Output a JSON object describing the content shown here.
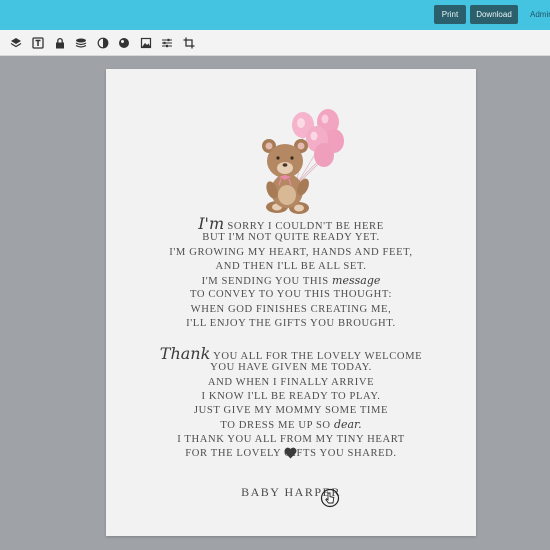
{
  "header": {
    "print_label": "Print",
    "download_label": "Download",
    "admin_label": "Admin"
  },
  "toolbar": {
    "tools": [
      "layers-icon",
      "text-icon",
      "lock-icon",
      "stack-icon",
      "contrast-icon",
      "color-icon",
      "image-icon",
      "adjust-icon",
      "crop-icon"
    ]
  },
  "poem": {
    "stanza1": [
      {
        "script": "I'm",
        "text": "SORRY I COULDN'T BE HERE"
      },
      {
        "text": "BUT I'M NOT QUITE READY YET."
      },
      {
        "text": "I'M GROWING MY HEART, HANDS AND FEET,"
      },
      {
        "text": "AND THEN I'LL BE ALL SET."
      },
      {
        "text": "I'M SENDING YOU THIS",
        "script_after": "message"
      },
      {
        "text": "TO CONVEY TO YOU THIS THOUGHT:"
      },
      {
        "text": "WHEN GOD FINISHES CREATING ME,"
      },
      {
        "text": "I'LL ENJOY THE GIFTS YOU BROUGHT."
      }
    ],
    "stanza2": [
      {
        "script": "Thank",
        "text": "YOU ALL FOR THE LOVELY WELCOME"
      },
      {
        "text": "YOU HAVE GIVEN ME TODAY."
      },
      {
        "text": "AND WHEN I FINALLY ARRIVE"
      },
      {
        "text": "I KNOW I'LL BE READY TO PLAY."
      },
      {
        "text": "JUST GIVE MY MOMMY SOME TIME"
      },
      {
        "text": "TO DRESS ME UP SO",
        "script_after": "dear."
      },
      {
        "text": "I THANK YOU ALL FROM MY TINY HEART"
      },
      {
        "text": "FOR THE LOVELY GIFTS YOU SHARED."
      }
    ],
    "signature": "BABY HARPER"
  },
  "colors": {
    "topbar": "#45c4e2",
    "button": "#2c5f6c",
    "balloon": "#f2a9c4",
    "bear": "#b0845f",
    "text": "#4e4e4e"
  }
}
